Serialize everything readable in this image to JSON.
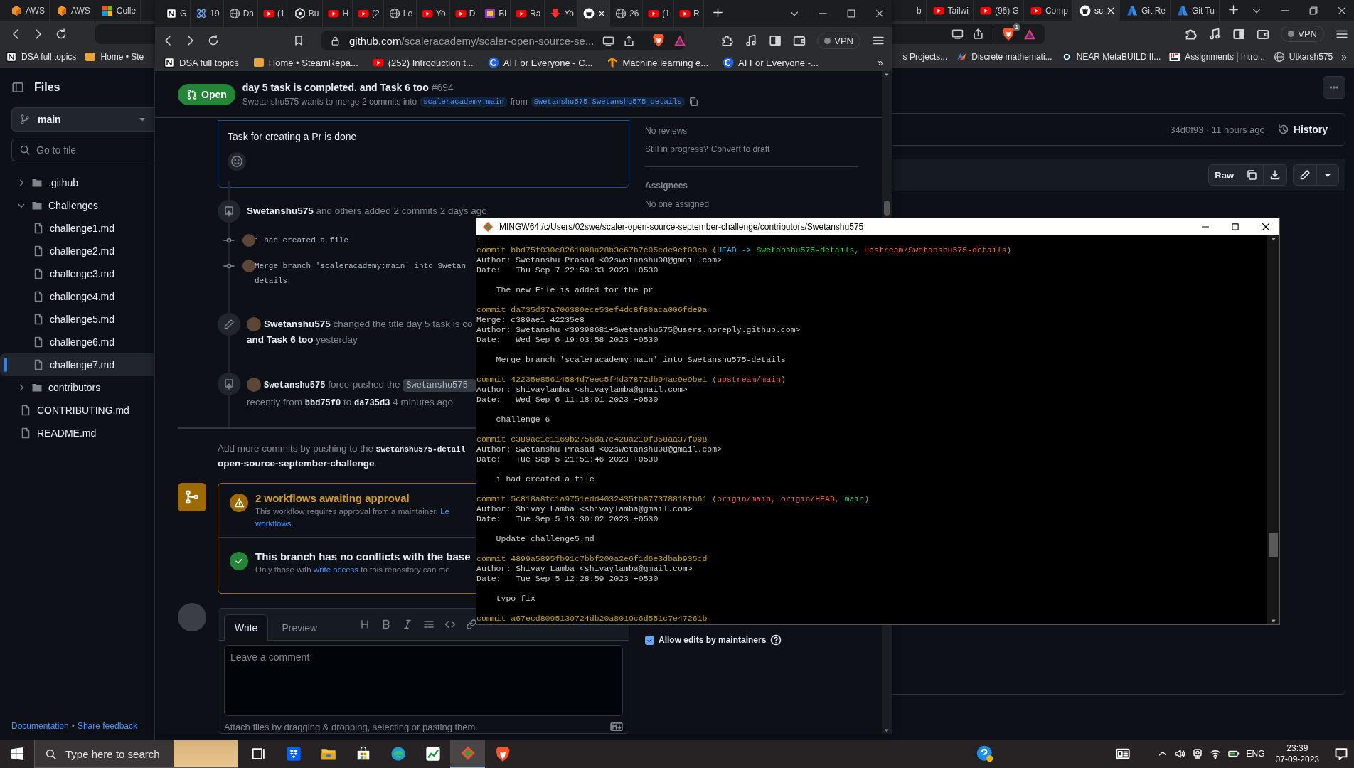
{
  "back_window": {
    "tabs_left": [
      {
        "kind": "cube",
        "label": "AWS",
        "selected": false
      },
      {
        "kind": "cube",
        "label": "AWS",
        "selected": false
      },
      {
        "kind": "squares",
        "label": "Colle",
        "selected": false
      }
    ],
    "tabs_right": [
      {
        "kind": "none",
        "label": "b",
        "selected": false
      },
      {
        "kind": "youtube",
        "label": "Tailwi",
        "selected": false
      },
      {
        "kind": "youtube",
        "label": "(96) G",
        "selected": false
      },
      {
        "kind": "youtube",
        "label": "Comp",
        "selected": false
      },
      {
        "kind": "github",
        "label": "sc",
        "selected": true
      },
      {
        "kind": "azure",
        "label": "Git Re",
        "selected": false
      },
      {
        "kind": "azure",
        "label": "Git Tu",
        "selected": false
      }
    ],
    "brave_badge": "1",
    "vpn": "VPN",
    "bookmarks_left": [
      {
        "kind": "notion",
        "label": "DSA full topics"
      },
      {
        "kind": "square",
        "label": "Home • Ste"
      }
    ],
    "bookmarks_right": [
      {
        "kind": "none",
        "label": "s Projects..."
      },
      {
        "kind": "sparkle",
        "label": "Discrete mathemati..."
      },
      {
        "kind": "dot",
        "label": "NEAR MetaBUILD II..."
      },
      {
        "kind": "block",
        "label": "Assignments | Intro..."
      },
      {
        "kind": "globe",
        "label": "Utkarsh575"
      }
    ],
    "bookmarks_overflow": "»",
    "repo_sidebar": {
      "title": "Files",
      "branch": "main",
      "search_placeholder": "Go to file",
      "tree": [
        {
          "kind": "folder",
          "name": ".github",
          "expanded": false,
          "selected": false
        },
        {
          "kind": "folder",
          "name": "Challenges",
          "expanded": true,
          "selected": false,
          "children": [
            {
              "kind": "file",
              "name": "challenge1.md",
              "selected": false
            },
            {
              "kind": "file",
              "name": "challenge2.md",
              "selected": false
            },
            {
              "kind": "file",
              "name": "challenge3.md",
              "selected": false
            },
            {
              "kind": "file",
              "name": "challenge4.md",
              "selected": false
            },
            {
              "kind": "file",
              "name": "challenge5.md",
              "selected": false
            },
            {
              "kind": "file",
              "name": "challenge6.md",
              "selected": false
            },
            {
              "kind": "file",
              "name": "challenge7.md",
              "selected": true
            }
          ]
        },
        {
          "kind": "folder",
          "name": "contributors",
          "expanded": false,
          "selected": false
        },
        {
          "kind": "file",
          "name": "CONTRIBUTING.md",
          "selected": false
        },
        {
          "kind": "file",
          "name": "README.md",
          "selected": false
        }
      ],
      "footer_links": [
        "Documentation",
        "Share feedback"
      ],
      "footer_separator": "•"
    },
    "file_view": {
      "commit_info": "34d0f93 · 11 hours ago",
      "history": "History",
      "raw": "Raw"
    }
  },
  "front_window": {
    "tabs": [
      {
        "kind": "notion",
        "label": "G",
        "selected": false
      },
      {
        "kind": "atom",
        "label": "19",
        "selected": false
      },
      {
        "kind": "globe",
        "label": "Da",
        "selected": false
      },
      {
        "kind": "youtube",
        "label": "(1",
        "selected": false
      },
      {
        "kind": "hexagon",
        "label": "Bu",
        "selected": false
      },
      {
        "kind": "youtube",
        "label": "H",
        "selected": false
      },
      {
        "kind": "youtube",
        "label": "(2",
        "selected": false
      },
      {
        "kind": "globe",
        "label": "Le",
        "selected": false
      },
      {
        "kind": "youtube",
        "label": "Yo",
        "selected": false
      },
      {
        "kind": "youtube",
        "label": "D",
        "selected": false
      },
      {
        "kind": "picture",
        "label": "Bi",
        "selected": false
      },
      {
        "kind": "youtube",
        "label": "Ra",
        "selected": false
      },
      {
        "kind": "download",
        "label": "Yo",
        "selected": false
      },
      {
        "kind": "github",
        "selected": true
      },
      {
        "kind": "globe",
        "label": "26",
        "selected": false
      },
      {
        "kind": "youtube",
        "label": "(1",
        "selected": false
      },
      {
        "kind": "youtube",
        "label": "R",
        "selected": false
      }
    ],
    "url": {
      "host": "github.com",
      "path": "/scaleracademy/scaler-open-source-se..."
    },
    "vpn": "VPN",
    "bookmarks": [
      {
        "kind": "notion",
        "label": "DSA full topics"
      },
      {
        "kind": "square",
        "label": "Home • SteamRepa..."
      },
      {
        "kind": "youtube",
        "label": "(252) Introduction t..."
      },
      {
        "kind": "ring",
        "label": "AI For Everyone - C..."
      },
      {
        "kind": "fan",
        "label": "Machine learning e..."
      },
      {
        "kind": "ring",
        "label": "AI For Everyone -..."
      }
    ],
    "bookmarks_overflow": "»",
    "pr": {
      "state": "Open",
      "title": "day 5 task is completed. and Task 6 too",
      "number": "#694",
      "summary": "Swetanshu575 wants to merge 2 commits into",
      "base": "scaleracademy:main",
      "from_word": "from",
      "head": "Swetanshu575:Swetanshu575-details",
      "comment": "Task for creating a Pr is done",
      "timeline": [
        {
          "kind": "commits",
          "text": "**Swetanshu575** and others added 2 commits 2 days ago",
          "commits": [
            {
              "lines": [
                "i had created a file"
              ]
            },
            {
              "lines": [
                "Merge branch 'scaleracademy:main' into Swetan",
                "details"
              ]
            }
          ]
        },
        {
          "kind": "rename",
          "text": "**Swetanshu575** changed the title",
          "old_title": "day 5 task is co",
          "new_title": "and Task 6 too",
          "time": "yesterday"
        },
        {
          "kind": "force_push",
          "text": "**Swetanshu575** force-pushed the",
          "branch": "Swetanshu575-",
          "detail": "recently from **bbd75f0** to **da735d3** 4 minutes ago"
        }
      ],
      "push_hint": [
        "Add more commits by pushing to the **Swetanshu575-detail**",
        "**open-source-september-challenge**."
      ],
      "checks": [
        {
          "kind": "warning",
          "title": "2 workflows awaiting approval",
          "lines": [
            [
              {
                "text": "This workflow requires approval from a maintainer. ",
                "link": false
              },
              {
                "text": "Le",
                "link": true
              }
            ],
            [
              {
                "text": "workflows.",
                "link": true
              }
            ]
          ]
        },
        {
          "kind": "success",
          "title": "This branch has no conflicts with the base",
          "lines": [
            [
              {
                "text": "Only those with ",
                "link": false
              },
              {
                "text": "write access",
                "link": true
              },
              {
                "text": " to this repository can me",
                "link": false
              }
            ]
          ]
        }
      ],
      "composer": {
        "tabs": [
          {
            "label": "Write",
            "selected": true
          },
          {
            "label": "Preview",
            "selected": false
          }
        ],
        "placeholder": "Leave a comment",
        "footer": "Attach files by dragging & dropping, selecting or pasting them."
      },
      "sidebar": {
        "reviews": "No reviews",
        "draft_prompt": "Still in progress?",
        "draft_link": "Convert to draft",
        "assignees_title": "Assignees",
        "assignees": "No one assigned",
        "allow_edits": {
          "label": "Allow edits by maintainers",
          "checked": true
        }
      }
    }
  },
  "terminal": {
    "title": "MINGW64:/c/Users/02swe/scaler-open-source-september-challenge/contributors/Swetanshu575",
    "prompt": ":",
    "commits": [
      {
        "header": [
          {
            "text": "commit bbd75f030c8261898a28b3e67b7c05cde9ef03cb (",
            "color": "#c4a000"
          },
          {
            "text": "HEAD -> ",
            "color": "#3bb4e0"
          },
          {
            "text": "Swetanshu575-details",
            "color": "#23d160"
          },
          {
            "text": ", "
          },
          {
            "text": "upstream/Swetanshu575-details",
            "color": "#e8615b"
          },
          {
            "text": ")"
          }
        ],
        "meta": [
          "Author: Swetanshu Prasad <02swetanshu08@gmail.com>",
          "Date:   Thu Sep 7 22:59:33 2023 +0530"
        ],
        "message": "The new File is added for the pr"
      },
      {
        "header": [
          {
            "text": "commit da735d37a706380ece53ef4dc8f80aca006fde9a",
            "color": "#c4a000"
          }
        ],
        "meta": [
          "Merge: c389ae1 42235e8",
          "Author: Swetanshu <39398681+Swetanshu575@users.noreply.github.com>",
          "Date:   Wed Sep 6 19:03:58 2023 +0530"
        ],
        "message": "Merge branch 'scaleracademy:main' into Swetanshu575-details"
      },
      {
        "header": [
          {
            "text": "commit 42235e85614584d7eec5f4d37872db94ac9e9be1 (",
            "color": "#c4a000"
          },
          {
            "text": "upstream/main",
            "color": "#e8615b"
          },
          {
            "text": ")"
          }
        ],
        "meta": [
          "Author: shivaylamba <shivaylamba@gmail.com>",
          "Date:   Wed Sep 6 11:18:01 2023 +0530"
        ],
        "message": "challenge 6"
      },
      {
        "header": [
          {
            "text": "commit c389ae1e1169b2756da7c428a210f358aa37f098",
            "color": "#c4a000"
          }
        ],
        "meta": [
          "Author: Swetanshu Prasad <02swetanshu08@gmail.com>",
          "Date:   Tue Sep 5 21:51:46 2023 +0530"
        ],
        "message": "i had created a file"
      },
      {
        "header": [
          {
            "text": "commit 5c818a8fc1a9751edd4032435fb877378818fb61 (",
            "color": "#c4a000"
          },
          {
            "text": "origin/main",
            "color": "#e8615b"
          },
          {
            "text": ", "
          },
          {
            "text": "origin/HEAD",
            "color": "#e8615b"
          },
          {
            "text": ", "
          },
          {
            "text": "main",
            "color": "#23d160"
          },
          {
            "text": ")"
          }
        ],
        "meta": [
          "Author: Shivay Lamba <shivaylamba@gmail.com>",
          "Date:   Tue Sep 5 13:30:02 2023 +0530"
        ],
        "message": "Update challenge5.md"
      },
      {
        "header": [
          {
            "text": "commit 4899a5895fb91c7bbf200a2e6f1d6e3dbab935cd",
            "color": "#c4a000"
          }
        ],
        "meta": [
          "Author: Shivay Lamba <shivaylamba@gmail.com>",
          "Date:   Tue Sep 5 12:28:59 2023 +0530"
        ],
        "message": "typo fix"
      },
      {
        "header": [
          {
            "text": "commit a67ecd8095130724db20a8010c6d551c7e47261b",
            "color": "#c4a000"
          }
        ]
      }
    ]
  },
  "taskbar": {
    "search_placeholder": "Type here to search",
    "apps": [
      {
        "kind": "taskview",
        "selected": false
      },
      {
        "kind": "dropbox",
        "selected": false
      },
      {
        "kind": "explorer",
        "selected": false
      },
      {
        "kind": "store",
        "selected": false
      },
      {
        "kind": "edge",
        "selected": false
      },
      {
        "kind": "chart",
        "selected": false
      },
      {
        "kind": "git",
        "selected": true
      },
      {
        "kind": "brave",
        "selected": false
      }
    ],
    "language": "ENG",
    "time": "23:39",
    "date": "07-09-2023"
  }
}
